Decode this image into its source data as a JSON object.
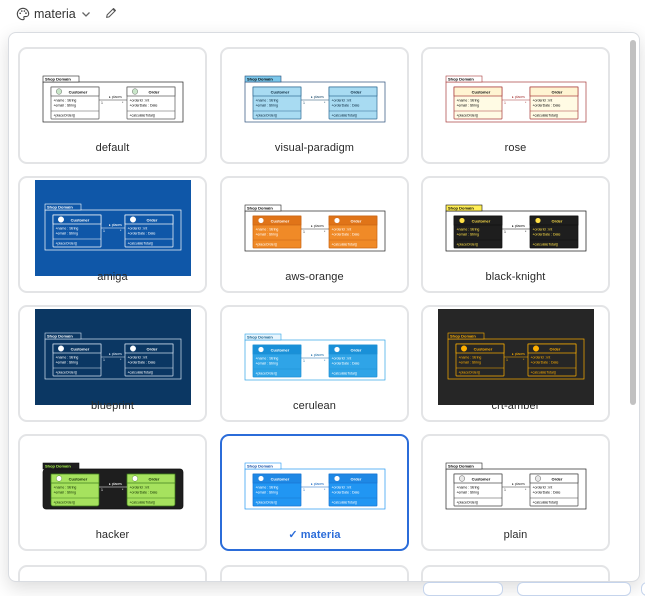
{
  "toolbar": {
    "theme_label": "materia",
    "palette_icon": "palette-icon",
    "dropdown_icon": "chevron-down-icon",
    "edit_icon": "pencil-icon"
  },
  "preview": {
    "group": "Shop Domain",
    "customer": "Customer",
    "order": "Order",
    "customer_attrs": [
      "name : String",
      "email : String"
    ],
    "customer_ops": [
      "placeOrder()"
    ],
    "order_attrs": [
      "orderId : int",
      "orderDate : Date"
    ],
    "order_ops": [
      "calculateTotal()"
    ],
    "assoc_label": "places",
    "multiplicity_left": "1",
    "multiplicity_right": "*"
  },
  "themes": [
    {
      "name": "default",
      "bg": "#ffffff",
      "frame": "#222222",
      "groupFill": "#ffffff",
      "groupText": "#000000",
      "boxFill": "#ffffff",
      "headFill": "#ffffff",
      "boxStroke": "#555555",
      "text": "#000000",
      "line": "#333333",
      "icon": "#c9e6c9",
      "wide": false
    },
    {
      "name": "visual-paradigm",
      "bg": "#ffffff",
      "frame": "#2a4f7a",
      "groupFill": "#7cc7ea",
      "groupText": "#000000",
      "boxFill": "#a8dbf2",
      "headFill": "#a8dbf2",
      "boxStroke": "#2f6b94",
      "text": "#001d33",
      "line": "#1f4c6b",
      "icon": "",
      "wide": false
    },
    {
      "name": "rose",
      "bg": "#ffffff",
      "frame": "#a83a3a",
      "groupFill": "#ffffff",
      "groupText": "#000000",
      "boxFill": "#fffbe4",
      "headFill": "#fff4d2",
      "boxStroke": "#a83a3a",
      "text": "#000000",
      "line": "#a83a3a",
      "icon": "",
      "wide": false
    },
    {
      "name": "amiga",
      "bg": "#0f57a8",
      "frame": "#ffffff",
      "groupFill": "#0f57a8",
      "groupText": "#ffffff",
      "boxFill": "#0f57a8",
      "headFill": "#0f57a8",
      "boxStroke": "#ffffff",
      "text": "#ffffff",
      "line": "#ffffff",
      "icon": "#ffffff",
      "wide": true
    },
    {
      "name": "aws-orange",
      "bg": "#ffffff",
      "frame": "#222222",
      "groupFill": "#ffffff",
      "groupText": "#000000",
      "boxFill": "#f08a27",
      "headFill": "#e07418",
      "boxStroke": "#c86515",
      "text": "#ffffff",
      "line": "#333333",
      "icon": "#ffffff",
      "wide": false
    },
    {
      "name": "black-knight",
      "bg": "#ffffff",
      "frame": "#111111",
      "groupFill": "#ffee55",
      "groupText": "#000000",
      "boxFill": "#1e1e1e",
      "headFill": "#1e1e1e",
      "boxStroke": "#111111",
      "text": "#ffe047",
      "line": "#111111",
      "icon": "#ffe047",
      "wide": false
    },
    {
      "name": "blueprint",
      "bg": "#0b3763",
      "frame": "#d8e4f2",
      "groupFill": "#0b3763",
      "groupText": "#ffffff",
      "boxFill": "#0b3763",
      "headFill": "#0b3763",
      "boxStroke": "#d8e4f2",
      "text": "#ffffff",
      "line": "#d8e4f2",
      "icon": "#ffffff",
      "wide": true
    },
    {
      "name": "cerulean",
      "bg": "#ffffff",
      "frame": "#2fa4e7",
      "groupFill": "#e8f5fd",
      "groupText": "#0b5a8a",
      "boxFill": "#2fa4e7",
      "headFill": "#1990d8",
      "boxStroke": "#1e8fd3",
      "text": "#ffffff",
      "line": "#1e6fa8",
      "icon": "#ffffff",
      "wide": false
    },
    {
      "name": "crt-amber",
      "bg": "#262626",
      "frame": "#ffb000",
      "groupFill": "#262626",
      "groupText": "#ffb000",
      "boxFill": "#262626",
      "headFill": "#262626",
      "boxStroke": "#ffb000",
      "text": "#ffb000",
      "line": "#ffb000",
      "icon": "#ffb000",
      "wide": true
    },
    {
      "name": "hacker",
      "bg": "#ffffff",
      "frame": "#111111",
      "groupFill": "#1e1e1e",
      "groupText": "#a6f24a",
      "boxFill": "#a6e25e",
      "headFill": "#a6e25e",
      "boxStroke": "#3c7a1a",
      "text": "#0e2a00",
      "line": "#ffffff",
      "icon": "#ffffff",
      "wide": false
    },
    {
      "name": "materia",
      "bg": "#ffffff",
      "frame": "#2196f3",
      "groupFill": "#ffffff",
      "groupText": "#0d47a1",
      "boxFill": "#2196f3",
      "headFill": "#1e88e5",
      "boxStroke": "#1976d2",
      "text": "#ffffff",
      "line": "#1565c0",
      "icon": "#ffffff",
      "wide": false
    },
    {
      "name": "plain",
      "bg": "#ffffff",
      "frame": "#222222",
      "groupFill": "#ffffff",
      "groupText": "#000000",
      "boxFill": "#ffffff",
      "headFill": "#ffffff",
      "boxStroke": "#444444",
      "text": "#000000",
      "line": "#333333",
      "icon": "#e8e8e8",
      "wide": false
    }
  ],
  "selected_theme": "materia",
  "selected_marker": "✓",
  "accent_color": "#2b6cd9"
}
